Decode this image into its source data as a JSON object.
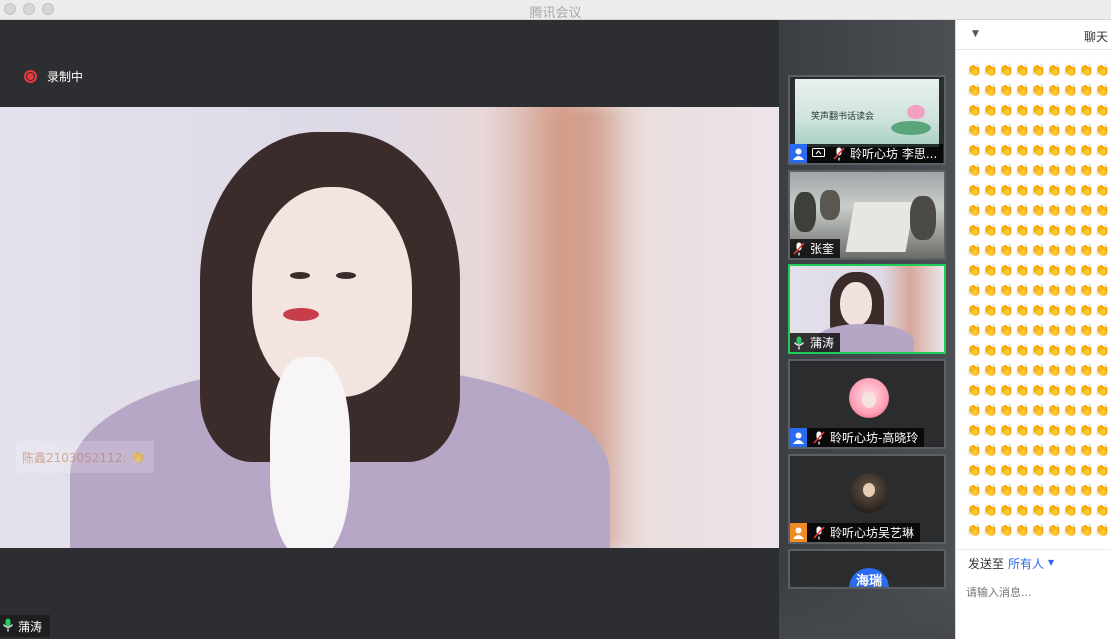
{
  "window": {
    "title": "腾讯会议"
  },
  "recording": {
    "label": "录制中",
    "color": "#e83a3a"
  },
  "main_video": {
    "watermark_text": "陈鑫2103052112: ",
    "speaker_name": "蒲涛"
  },
  "participants": [
    {
      "name": "聆听心坊 李思...",
      "role_icon": "host-user-icon",
      "share_icon": "screen-share-icon",
      "mic": "mic-muted-icon",
      "slide_text": "笑声翻书话读会"
    },
    {
      "name": "张奎",
      "role_icon": "",
      "mic": "mic-muted-icon"
    },
    {
      "name": "蒲涛",
      "role_icon": "",
      "mic": "mic-on-icon",
      "active": true
    },
    {
      "name": "聆听心坊-高晓玲",
      "role_icon": "host-user-icon",
      "mic": "mic-muted-icon"
    },
    {
      "name": "聆听心坊吴艺琳",
      "role_icon": "cohost-user-icon",
      "mic": "mic-muted-icon"
    },
    {
      "name": "",
      "avatar_text": "海瑞"
    }
  ],
  "chat": {
    "header": "聊天",
    "message_emoji": "👏",
    "send_to_label": "发送至",
    "send_to_value": "所有人",
    "input_placeholder": "请输入消息..."
  },
  "colors": {
    "active_border": "#1fcc55",
    "accent": "#2a6cf1",
    "orange": "#f08a24"
  }
}
